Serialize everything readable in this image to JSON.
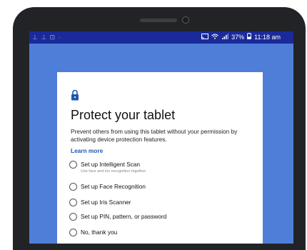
{
  "status_bar": {
    "left_icons": "⊥ ⊥ ⊡ ·",
    "right_icons": [
      "cast-icon",
      "wifi-icon",
      "signal-icon"
    ],
    "battery": "37%",
    "time": "11:18 am"
  },
  "card": {
    "title": "Protect your tablet",
    "description": "Prevent others from using this tablet without your permission by activating device protection features.",
    "learn_more": "Learn more",
    "options": [
      {
        "label": "Set up Intelligent Scan",
        "sublabel": "Use face and iris recognition together."
      },
      {
        "label": "Set up Face Recognition"
      },
      {
        "label": "Set up Iris Scanner"
      },
      {
        "label": "Set up PIN, pattern, or password"
      },
      {
        "label": "No, thank you"
      }
    ]
  },
  "colors": {
    "accent": "#1f56b3",
    "screen_background": "#4f7ed8",
    "status_bar": "#1a2a9a",
    "bezel": "#222326"
  }
}
